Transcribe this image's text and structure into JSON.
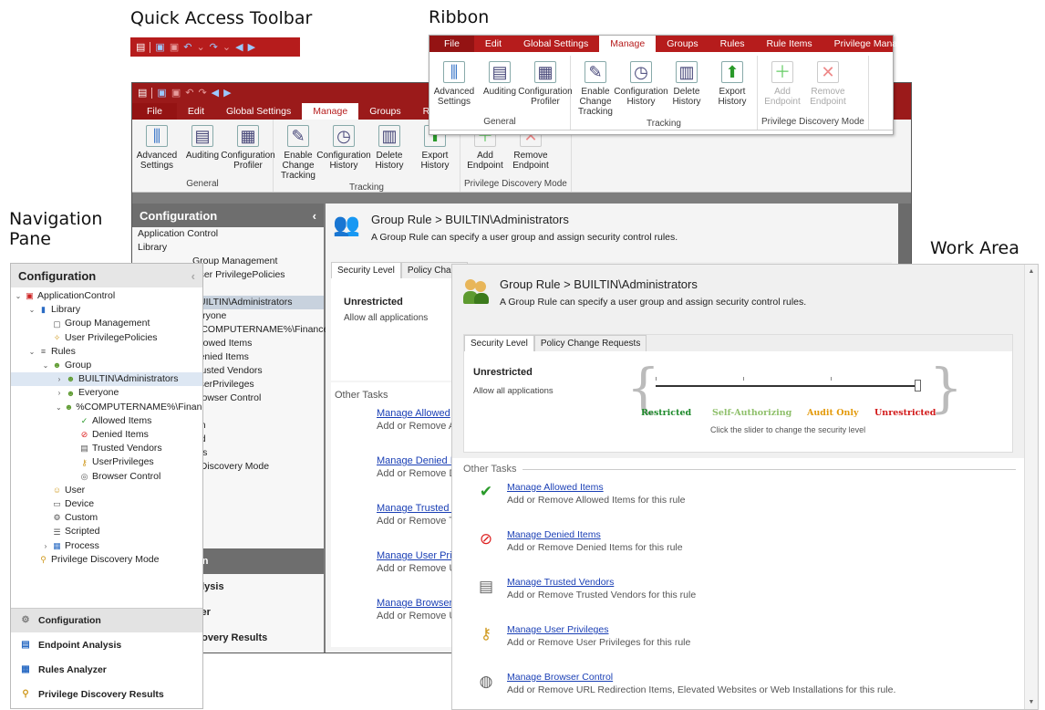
{
  "captions": {
    "qat": "Quick Access Toolbar",
    "ribbon": "Ribbon",
    "nav": "Navigation\nPane",
    "work": "Work Area"
  },
  "ribbon": {
    "tabs": [
      "File",
      "Edit",
      "Global Settings",
      "Manage",
      "Groups",
      "Rules",
      "Rule Items",
      "Privilege Management"
    ],
    "active_tab": "Manage",
    "groups": [
      {
        "label": "General",
        "buttons": [
          {
            "label": "Advanced Settings",
            "icon": "sliders-icon"
          },
          {
            "label": "Auditing",
            "icon": "clipboard-icon"
          },
          {
            "label": "Configuration Profiler",
            "icon": "profiler-icon"
          }
        ]
      },
      {
        "label": "Tracking",
        "buttons": [
          {
            "label": "Enable Change Tracking",
            "icon": "pencil-doc-icon"
          },
          {
            "label": "Configuration History",
            "icon": "history-icon"
          },
          {
            "label": "Delete History",
            "icon": "trash-icon"
          },
          {
            "label": "Export History",
            "icon": "export-arrow-icon"
          }
        ]
      },
      {
        "label": "Privilege Discovery Mode",
        "buttons": [
          {
            "label": "Add Endpoint",
            "icon": "add-endpoint-icon",
            "disabled": true
          },
          {
            "label": "Remove Endpoint",
            "icon": "remove-endpoint-icon",
            "disabled": true
          }
        ]
      }
    ]
  },
  "back_window": {
    "tabs": [
      "File",
      "Edit",
      "Global Settings",
      "Manage",
      "Groups",
      "Rules"
    ],
    "nav_items": [
      "Application Control",
      "Library",
      "Group Management",
      "User PrivilegePolicies",
      "p",
      "BUILTIN\\Administrators",
      "veryone",
      "%COMPUTERNAME%\\Finance",
      "Allowed Items",
      "Denied Items",
      "Trusted Vendors",
      "UserPrivileges",
      "Browser Control",
      "ce",
      "om",
      "ted",
      "ess",
      "e Discovery Mode"
    ],
    "nav_buttons": [
      "on",
      "alysis",
      "zer",
      "covery Results"
    ],
    "sec_tab_2": "Policy Chang",
    "level": "Unrestricted",
    "level_desc": "Allow all applications",
    "other_tasks": "Other Tasks",
    "task_links": [
      "Manage Allowed",
      "Manage Denied It",
      "Manage Trusted V",
      "Manage User Priv",
      "Manage Browser"
    ],
    "task_descs": [
      "Add or Remove A",
      "Add or Remove D",
      "Add or Remove T",
      "Add or Remove U",
      "Add or Remove U"
    ]
  },
  "nav": {
    "header": "Configuration",
    "tree": [
      {
        "label": "ApplicationControl",
        "level": 0,
        "twisty": "v",
        "icon": "app-control-icon"
      },
      {
        "label": "Library",
        "level": 1,
        "twisty": "v",
        "icon": "library-icon"
      },
      {
        "label": "Group Management",
        "level": 2,
        "twisty": "",
        "icon": "group-management-icon"
      },
      {
        "label": "User PrivilegePolicies",
        "level": 2,
        "twisty": "",
        "icon": "privilege-policy-icon"
      },
      {
        "label": "Rules",
        "level": 1,
        "twisty": "v",
        "icon": "rules-icon"
      },
      {
        "label": "Group",
        "level": 2,
        "twisty": "v",
        "icon": "group-icon"
      },
      {
        "label": "BUILTIN\\Administrators",
        "level": 3,
        "twisty": ">",
        "icon": "group-icon",
        "selected": true
      },
      {
        "label": "Everyone",
        "level": 3,
        "twisty": ">",
        "icon": "group-icon"
      },
      {
        "label": "%COMPUTERNAME%\\Finance",
        "level": 3,
        "twisty": "v",
        "icon": "group-icon"
      },
      {
        "label": "Allowed Items",
        "level": 4,
        "twisty": "",
        "icon": "allowed-icon"
      },
      {
        "label": "Denied Items",
        "level": 4,
        "twisty": "",
        "icon": "denied-icon"
      },
      {
        "label": "Trusted Vendors",
        "level": 4,
        "twisty": "",
        "icon": "trusted-vendor-icon"
      },
      {
        "label": "UserPrivileges",
        "level": 4,
        "twisty": "",
        "icon": "user-privilege-icon"
      },
      {
        "label": "Browser Control",
        "level": 4,
        "twisty": "",
        "icon": "browser-icon"
      },
      {
        "label": "User",
        "level": 2,
        "twisty": "",
        "icon": "user-icon"
      },
      {
        "label": "Device",
        "level": 2,
        "twisty": "",
        "icon": "device-icon"
      },
      {
        "label": "Custom",
        "level": 2,
        "twisty": "",
        "icon": "custom-icon"
      },
      {
        "label": "Scripted",
        "level": 2,
        "twisty": "",
        "icon": "scripted-icon"
      },
      {
        "label": "Process",
        "level": 2,
        "twisty": ">",
        "icon": "process-icon"
      },
      {
        "label": "Privilege Discovery Mode",
        "level": 1,
        "twisty": "",
        "icon": "discovery-icon"
      }
    ],
    "buttons": [
      {
        "label": "Configuration",
        "icon": "gear-icon",
        "active": true
      },
      {
        "label": "Endpoint Analysis",
        "icon": "endpoint-analysis-icon"
      },
      {
        "label": "Rules Analyzer",
        "icon": "rules-analyzer-icon"
      },
      {
        "label": "Privilege Discovery Results",
        "icon": "discovery-results-icon"
      }
    ]
  },
  "work": {
    "title": "Group Rule > BUILTIN\\Administrators",
    "subtitle": "A Group Rule can specify a user group and assign security control rules.",
    "tabs": [
      "Security Level",
      "Policy Change Requests"
    ],
    "level_title": "Unrestricted",
    "level_desc": "Allow all applications",
    "slider_labels": [
      "Restricted",
      "Self-Authorizing",
      "Audit Only",
      "Unrestricted"
    ],
    "slider_colors": [
      "#1e8a2b",
      "#8fc06b",
      "#e39a0b",
      "#d21a1a"
    ],
    "slider_hint": "Click the slider to change the security level",
    "other_tasks": "Other Tasks",
    "tasks": [
      {
        "link": "Manage Allowed Items",
        "desc": "Add or Remove Allowed Items for this rule",
        "icon": "allowed-check-icon"
      },
      {
        "link": "Manage Denied Items",
        "desc": "Add or Remove Denied Items for this rule",
        "icon": "denied-circle-icon"
      },
      {
        "link": "Manage Trusted Vendors",
        "desc": "Add or Remove Trusted Vendors for this rule",
        "icon": "trusted-vendor-icon"
      },
      {
        "link": "Manage User Privileges",
        "desc": "Add or Remove User Privileges for this rule",
        "icon": "user-key-icon"
      },
      {
        "link": "Manage Browser Control",
        "desc": "Add or Remove URL Redirection Items, Elevated Websites or Web Installations for this rule.",
        "icon": "globe-icon"
      }
    ]
  }
}
